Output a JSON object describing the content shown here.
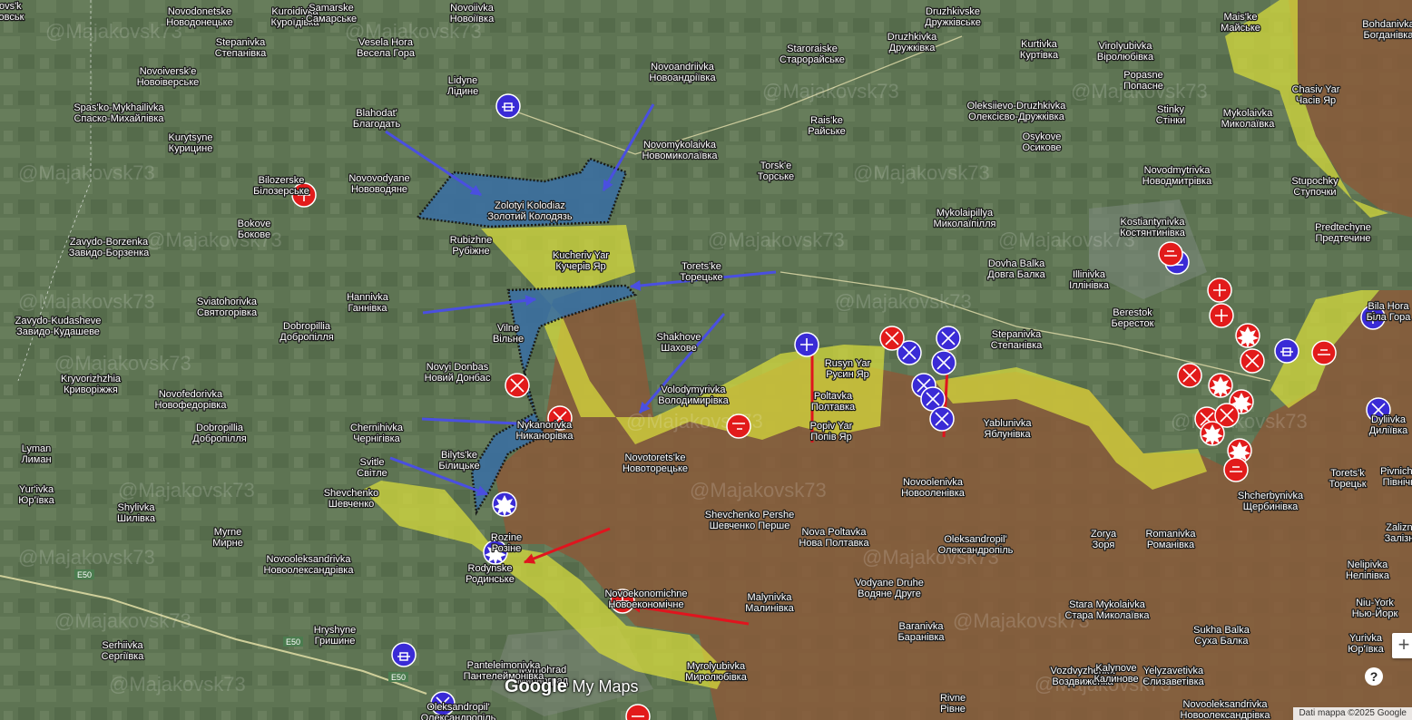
{
  "watermark": "@Majakovsk73",
  "logo": {
    "google": "Google",
    "mymaps": "My Maps"
  },
  "attribution": "Dati mappa ©2025 Google",
  "controls": {
    "zoom_in": "+",
    "help": "?"
  },
  "colors": {
    "russian_control": "#8a5a3a",
    "contested_gray": "#d9de3c",
    "ukrainian_advance": "#3b6fa0",
    "ukrainian_marker": "#3a2bd6",
    "russian_marker": "#e21b1b"
  },
  "places": [
    {
      "latin": "Novodonetske",
      "cyr": "Новодонецьке"
    },
    {
      "latin": "Kuroidivka",
      "cyr": "Куроїдівка"
    },
    {
      "latin": "Samarske",
      "cyr": "Самарське"
    },
    {
      "latin": "Novoiivka",
      "cyr": "Новоіївка"
    },
    {
      "latin": "Druzhkivske",
      "cyr": "Дружківське"
    },
    {
      "latin": "Stepanivka",
      "cyr": "Степанівка"
    },
    {
      "latin": "Vesela Hora",
      "cyr": "Весела Гора"
    },
    {
      "latin": "Novoandriivka",
      "cyr": "Новоандріївка"
    },
    {
      "latin": "Staroraiske",
      "cyr": "Старорайське"
    },
    {
      "latin": "Druzhkivka",
      "cyr": "Дружківка"
    },
    {
      "latin": "Kurtivka",
      "cyr": "Куртівка"
    },
    {
      "latin": "Virolyubivka",
      "cyr": "Віролюбівка"
    },
    {
      "latin": "Mais'ke",
      "cyr": "Майське"
    },
    {
      "latin": "Bohdanivka",
      "cyr": "Богданівка"
    },
    {
      "latin": "Novoiversk'e",
      "cyr": "Новоіверське"
    },
    {
      "latin": "Lidyne",
      "cyr": "Лідине"
    },
    {
      "latin": "Popasne",
      "cyr": "Попасне"
    },
    {
      "latin": "Oleksiievo-Druzhkivka",
      "cyr": "Олексієво-Дружківка"
    },
    {
      "latin": "Chasiv Yar",
      "cyr": "Часів Яр"
    },
    {
      "latin": "Spas'ko-Mykhailivka",
      "cyr": "Спаско-Михайлівка"
    },
    {
      "latin": "Blahodat'",
      "cyr": "Благодать"
    },
    {
      "latin": "Novomykolaivka",
      "cyr": "Новомиколаївка"
    },
    {
      "latin": "Stinky",
      "cyr": "Стінки"
    },
    {
      "latin": "Mykolaivka",
      "cyr": "Миколаївка"
    },
    {
      "latin": "Rais'ke",
      "cyr": "Райське"
    },
    {
      "latin": "Osykove",
      "cyr": "Осикове"
    },
    {
      "latin": "Kurytsyne",
      "cyr": "Курицине"
    },
    {
      "latin": "Novovodyane",
      "cyr": "Нововодяне"
    },
    {
      "latin": "Torsk'e",
      "cyr": "Торське"
    },
    {
      "latin": "Novodmytrivka",
      "cyr": "Новодмитрівка"
    },
    {
      "latin": "Stupochky",
      "cyr": "Ступочки"
    },
    {
      "latin": "Bilozerske",
      "cyr": "Білозерське"
    },
    {
      "latin": "Zolotyi Kolodiaz",
      "cyr": "Золотий Колодязь"
    },
    {
      "latin": "Mykolaipillya",
      "cyr": "Миколаїпілля"
    },
    {
      "latin": "Kostiantynivka",
      "cyr": "Костянтинівка"
    },
    {
      "latin": "Bokove",
      "cyr": "Бокове"
    },
    {
      "latin": "Predtechyne",
      "cyr": "Предтечине"
    },
    {
      "latin": "Zavydo-Borzenka",
      "cyr": "Завидо-Борзенка"
    },
    {
      "latin": "Rubizhne",
      "cyr": "Рубіжне"
    },
    {
      "latin": "Kucheriv Yar",
      "cyr": "Кучерів Яр"
    },
    {
      "latin": "Torets'ke",
      "cyr": "Торецьке"
    },
    {
      "latin": "Illinivka",
      "cyr": "Іллінівка"
    },
    {
      "latin": "Dovha Balka",
      "cyr": "Довга Балка"
    },
    {
      "latin": "Berestok",
      "cyr": "Бересток"
    },
    {
      "latin": "Bila Hora",
      "cyr": "Біла Гора"
    },
    {
      "latin": "Hannivka",
      "cyr": "Ганнівка"
    },
    {
      "latin": "Sviatohorivka",
      "cyr": "Святогорівка"
    },
    {
      "latin": "Vilne",
      "cyr": "Вільне"
    },
    {
      "latin": "Zavydo-Kudasheve",
      "cyr": "Завидо-Кудашеве"
    },
    {
      "latin": "Dobropillia",
      "cyr": "Добропілля"
    },
    {
      "latin": "Shakhove",
      "cyr": "Шахове"
    },
    {
      "latin": "Stepanivka",
      "cyr": "Степанівка"
    },
    {
      "latin": "Rusyn Yar",
      "cyr": "Русин Яр"
    },
    {
      "latin": "Novyi Donbas",
      "cyr": "Новий Донбас"
    },
    {
      "latin": "Volodymyrivka",
      "cyr": "Володимирівка"
    },
    {
      "latin": "Poltavka",
      "cyr": "Полтавка"
    },
    {
      "latin": "Popiv Yar",
      "cyr": "Попів Яр"
    },
    {
      "latin": "Yablunivka",
      "cyr": "Яблунівка"
    },
    {
      "latin": "Dyliivka",
      "cyr": "Диліївка"
    },
    {
      "latin": "Kryvorizhzhia",
      "cyr": "Криворіжжя"
    },
    {
      "latin": "Novofedorivka",
      "cyr": "Новофедорівка"
    },
    {
      "latin": "Dobropillia",
      "cyr": "Добропілля"
    },
    {
      "latin": "Nykanorivka",
      "cyr": "Никанорівка"
    },
    {
      "latin": "Chernihivka",
      "cyr": "Чернігівка"
    },
    {
      "latin": "Lyman",
      "cyr": "Лиман"
    },
    {
      "latin": "Novotorets'ke",
      "cyr": "Новоторецьке"
    },
    {
      "latin": "Novoolenivka",
      "cyr": "Новооленівка"
    },
    {
      "latin": "Torets'k",
      "cyr": "Торецьк"
    },
    {
      "latin": "Shcherbynivka",
      "cyr": "Щербинівка"
    },
    {
      "latin": "Pivnichne",
      "cyr": "Північне"
    },
    {
      "latin": "Bilyts'ke",
      "cyr": "Білицьке"
    },
    {
      "latin": "Svitle",
      "cyr": "Світле"
    },
    {
      "latin": "Shevchenko",
      "cyr": "Шевченко"
    },
    {
      "latin": "Yur'ivka",
      "cyr": "Юр'ївка"
    },
    {
      "latin": "Shylivka",
      "cyr": "Шилівка"
    },
    {
      "latin": "Shevchenko Pershe",
      "cyr": "Шевченко Перше"
    },
    {
      "latin": "Nova Poltavka",
      "cyr": "Нова Полтавка"
    },
    {
      "latin": "Oleksandropil'",
      "cyr": "Олександропіль"
    },
    {
      "latin": "Zorya",
      "cyr": "Зоря"
    },
    {
      "latin": "Romanivka",
      "cyr": "Романівка"
    },
    {
      "latin": "Myrne",
      "cyr": "Мирне"
    },
    {
      "latin": "Rozine",
      "cyr": "Розіне"
    },
    {
      "latin": "Novooleksandrivka",
      "cyr": "Новоолександрівка"
    },
    {
      "latin": "Rodynske",
      "cyr": "Родинське"
    },
    {
      "latin": "Nelipivka",
      "cyr": "Неліпівка"
    },
    {
      "latin": "Zalizne",
      "cyr": "Залізне"
    },
    {
      "latin": "Novoekonomichne",
      "cyr": "Новоекономічне"
    },
    {
      "latin": "Vodyane Druhe",
      "cyr": "Водяне Друге"
    },
    {
      "latin": "Malynivka",
      "cyr": "Малинівка"
    },
    {
      "latin": "Stara Mykolaivka",
      "cyr": "Стара Миколаївка"
    },
    {
      "latin": "Niu-York",
      "cyr": "Нью-Йорк"
    },
    {
      "latin": "Hryshyne",
      "cyr": "Гришине"
    },
    {
      "latin": "Baranivka",
      "cyr": "Баранівка"
    },
    {
      "latin": "Sukha Balka",
      "cyr": "Суха Балка"
    },
    {
      "latin": "Yurivka",
      "cyr": "Юр'ївка"
    },
    {
      "latin": "Serhiivka",
      "cyr": "Сергіївка"
    },
    {
      "latin": "Myrnohrad",
      "cyr": "Мирноград"
    },
    {
      "latin": "Myrolyubivka",
      "cyr": "Миролюбівка"
    },
    {
      "latin": "Yelyzavetivka",
      "cyr": "Єлизаветівка"
    },
    {
      "latin": "Vozdvyzhenka",
      "cyr": "Воздвиженка"
    },
    {
      "latin": "Kalynove",
      "cyr": "Калинове"
    },
    {
      "latin": "Panteleimonivka",
      "cyr": "Пантелеймонівка"
    },
    {
      "latin": "Rivne",
      "cyr": "Рівне"
    },
    {
      "latin": "Novooleksandrivka",
      "cyr": "Новоолександрівка"
    },
    {
      "latin": "Oleksandropil'",
      "cyr": "Олександропіль"
    },
    {
      "latin": "Pokrovs'k",
      "cyr": "Покровськ"
    }
  ],
  "road_labels": [
    "E50",
    "E50",
    "E50"
  ]
}
